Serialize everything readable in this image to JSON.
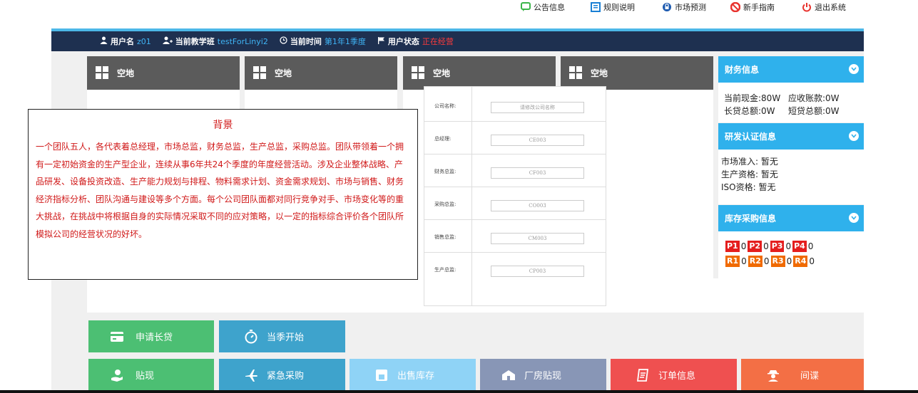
{
  "topnav": {
    "announcements": "公告信息",
    "rules": "规则说明",
    "forecast": "市场预测",
    "guide": "新手指南",
    "logout": "退出系统"
  },
  "status": {
    "username_label": "用户名",
    "username": "z01",
    "class_label": "当前教学班",
    "class": "testForLinyi2",
    "time_label": "当前时间",
    "time": "第1年1季度",
    "state_label": "用户状态",
    "state": "正在经营"
  },
  "slots": [
    "空地",
    "空地",
    "空地",
    "空地"
  ],
  "form": {
    "rows": [
      {
        "label": "公司名称:",
        "value": "请修改公司名称"
      },
      {
        "label": "总经理:",
        "value": "CE003"
      },
      {
        "label": "财务总监:",
        "value": "CF003"
      },
      {
        "label": "采购总监:",
        "value": "CO003"
      },
      {
        "label": "销售总监:",
        "value": "CM003"
      },
      {
        "label": "生产总监:",
        "value": "CP003"
      }
    ]
  },
  "background": {
    "title": "背景",
    "text": "一个团队五人，各代表着总经理，市场总监，财务总监，生产总监，采购总监。团队带领着一个拥有一定初始资金的生产型企业，连续从事6年共24个季度的年度经营活动。涉及企业整体战略、产品研发、设备投资改造、生产能力规划与排程、物料需求计划、资金需求规划、市场与销售、财务经济指标分析、团队沟通与建设等多个方面。每个公司团队面都对同行竞争对手、市场变化等的重大挑战，在挑战中将根据自身的实际情况采取不同的应对策略，以一定的指标综合评价各个团队所模拟公司的经营状况的好坏。"
  },
  "finance": {
    "title": "财务信息",
    "cash": "当前现金:80W",
    "receivable": "应收账款:0W",
    "long_loan": "长贷总额:0W",
    "short_loan": "短贷总额:0W"
  },
  "rd": {
    "title": "研发认证信息",
    "market": "市场准入: 暂无",
    "production": "生产资格: 暂无",
    "iso": "ISO资格: 暂无"
  },
  "stock": {
    "title": "库存采购信息",
    "products": [
      {
        "name": "P1",
        "qty": "0"
      },
      {
        "name": "P2",
        "qty": "0"
      },
      {
        "name": "P3",
        "qty": "0"
      },
      {
        "name": "P4",
        "qty": "0"
      }
    ],
    "materials": [
      {
        "name": "R1",
        "qty": "0"
      },
      {
        "name": "R2",
        "qty": "0"
      },
      {
        "name": "R3",
        "qty": "0"
      },
      {
        "name": "R4",
        "qty": "0"
      }
    ]
  },
  "actions": {
    "long_loan": "申请长贷",
    "start_season": "当季开始",
    "discount": "贴现",
    "urgent_purchase": "紧急采购",
    "sell_stock": "出售库存",
    "plant_discount": "厂房贴现",
    "order_info": "订单信息",
    "spy": "间谍"
  },
  "colors": {
    "nav_dark": "#1e3050",
    "accent_blue": "#2fb1ec",
    "green_btn": "#4cbf73",
    "teal_btn": "#3ea3cc",
    "light_blue_btn": "#8fd3f6",
    "slate_btn": "#8896b6",
    "red_btn": "#ef5050",
    "orange_btn": "#f36f45"
  }
}
